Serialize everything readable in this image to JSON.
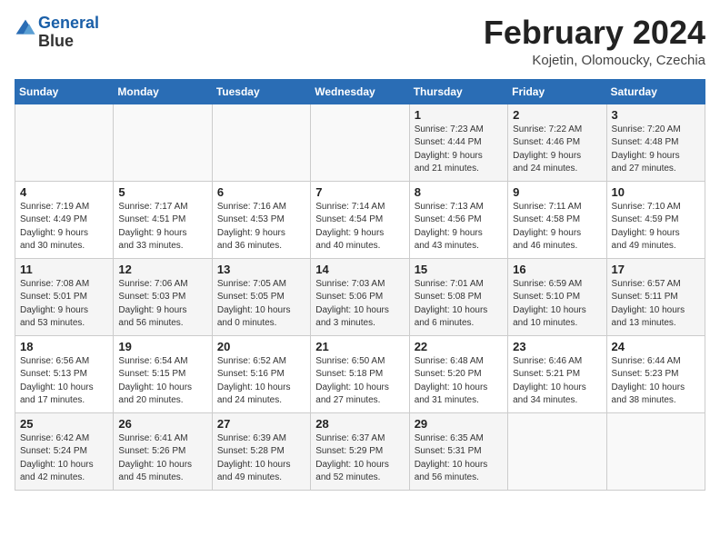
{
  "header": {
    "logo_line1": "General",
    "logo_line2": "Blue",
    "month_year": "February 2024",
    "location": "Kojetin, Olomoucky, Czechia"
  },
  "days_of_week": [
    "Sunday",
    "Monday",
    "Tuesday",
    "Wednesday",
    "Thursday",
    "Friday",
    "Saturday"
  ],
  "weeks": [
    [
      {
        "day": "",
        "info": ""
      },
      {
        "day": "",
        "info": ""
      },
      {
        "day": "",
        "info": ""
      },
      {
        "day": "",
        "info": ""
      },
      {
        "day": "1",
        "info": "Sunrise: 7:23 AM\nSunset: 4:44 PM\nDaylight: 9 hours\nand 21 minutes."
      },
      {
        "day": "2",
        "info": "Sunrise: 7:22 AM\nSunset: 4:46 PM\nDaylight: 9 hours\nand 24 minutes."
      },
      {
        "day": "3",
        "info": "Sunrise: 7:20 AM\nSunset: 4:48 PM\nDaylight: 9 hours\nand 27 minutes."
      }
    ],
    [
      {
        "day": "4",
        "info": "Sunrise: 7:19 AM\nSunset: 4:49 PM\nDaylight: 9 hours\nand 30 minutes."
      },
      {
        "day": "5",
        "info": "Sunrise: 7:17 AM\nSunset: 4:51 PM\nDaylight: 9 hours\nand 33 minutes."
      },
      {
        "day": "6",
        "info": "Sunrise: 7:16 AM\nSunset: 4:53 PM\nDaylight: 9 hours\nand 36 minutes."
      },
      {
        "day": "7",
        "info": "Sunrise: 7:14 AM\nSunset: 4:54 PM\nDaylight: 9 hours\nand 40 minutes."
      },
      {
        "day": "8",
        "info": "Sunrise: 7:13 AM\nSunset: 4:56 PM\nDaylight: 9 hours\nand 43 minutes."
      },
      {
        "day": "9",
        "info": "Sunrise: 7:11 AM\nSunset: 4:58 PM\nDaylight: 9 hours\nand 46 minutes."
      },
      {
        "day": "10",
        "info": "Sunrise: 7:10 AM\nSunset: 4:59 PM\nDaylight: 9 hours\nand 49 minutes."
      }
    ],
    [
      {
        "day": "11",
        "info": "Sunrise: 7:08 AM\nSunset: 5:01 PM\nDaylight: 9 hours\nand 53 minutes."
      },
      {
        "day": "12",
        "info": "Sunrise: 7:06 AM\nSunset: 5:03 PM\nDaylight: 9 hours\nand 56 minutes."
      },
      {
        "day": "13",
        "info": "Sunrise: 7:05 AM\nSunset: 5:05 PM\nDaylight: 10 hours\nand 0 minutes."
      },
      {
        "day": "14",
        "info": "Sunrise: 7:03 AM\nSunset: 5:06 PM\nDaylight: 10 hours\nand 3 minutes."
      },
      {
        "day": "15",
        "info": "Sunrise: 7:01 AM\nSunset: 5:08 PM\nDaylight: 10 hours\nand 6 minutes."
      },
      {
        "day": "16",
        "info": "Sunrise: 6:59 AM\nSunset: 5:10 PM\nDaylight: 10 hours\nand 10 minutes."
      },
      {
        "day": "17",
        "info": "Sunrise: 6:57 AM\nSunset: 5:11 PM\nDaylight: 10 hours\nand 13 minutes."
      }
    ],
    [
      {
        "day": "18",
        "info": "Sunrise: 6:56 AM\nSunset: 5:13 PM\nDaylight: 10 hours\nand 17 minutes."
      },
      {
        "day": "19",
        "info": "Sunrise: 6:54 AM\nSunset: 5:15 PM\nDaylight: 10 hours\nand 20 minutes."
      },
      {
        "day": "20",
        "info": "Sunrise: 6:52 AM\nSunset: 5:16 PM\nDaylight: 10 hours\nand 24 minutes."
      },
      {
        "day": "21",
        "info": "Sunrise: 6:50 AM\nSunset: 5:18 PM\nDaylight: 10 hours\nand 27 minutes."
      },
      {
        "day": "22",
        "info": "Sunrise: 6:48 AM\nSunset: 5:20 PM\nDaylight: 10 hours\nand 31 minutes."
      },
      {
        "day": "23",
        "info": "Sunrise: 6:46 AM\nSunset: 5:21 PM\nDaylight: 10 hours\nand 34 minutes."
      },
      {
        "day": "24",
        "info": "Sunrise: 6:44 AM\nSunset: 5:23 PM\nDaylight: 10 hours\nand 38 minutes."
      }
    ],
    [
      {
        "day": "25",
        "info": "Sunrise: 6:42 AM\nSunset: 5:24 PM\nDaylight: 10 hours\nand 42 minutes."
      },
      {
        "day": "26",
        "info": "Sunrise: 6:41 AM\nSunset: 5:26 PM\nDaylight: 10 hours\nand 45 minutes."
      },
      {
        "day": "27",
        "info": "Sunrise: 6:39 AM\nSunset: 5:28 PM\nDaylight: 10 hours\nand 49 minutes."
      },
      {
        "day": "28",
        "info": "Sunrise: 6:37 AM\nSunset: 5:29 PM\nDaylight: 10 hours\nand 52 minutes."
      },
      {
        "day": "29",
        "info": "Sunrise: 6:35 AM\nSunset: 5:31 PM\nDaylight: 10 hours\nand 56 minutes."
      },
      {
        "day": "",
        "info": ""
      },
      {
        "day": "",
        "info": ""
      }
    ]
  ]
}
